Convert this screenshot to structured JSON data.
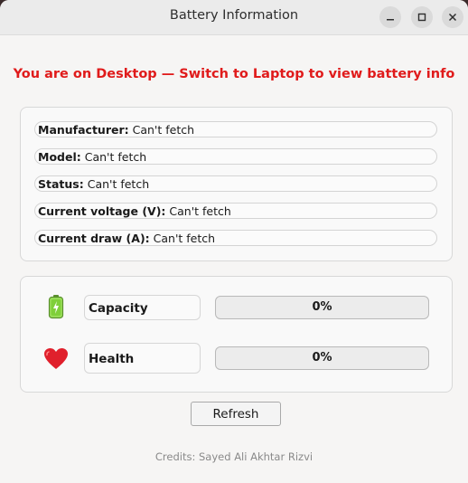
{
  "window": {
    "title": "Battery Information",
    "minimize_icon": "minimize-icon",
    "maximize_icon": "maximize-icon",
    "close_icon": "close-icon"
  },
  "warning": "You are on Desktop — Switch to Laptop to view battery info",
  "info": [
    {
      "label": "Manufacturer:",
      "value": "Can't fetch"
    },
    {
      "label": "Model:",
      "value": "Can't fetch"
    },
    {
      "label": "Status:",
      "value": "Can't fetch"
    },
    {
      "label": "Current voltage (V):",
      "value": "Can't fetch"
    },
    {
      "label": "Current draw (A):",
      "value": "Can't fetch"
    }
  ],
  "meters": [
    {
      "icon": "battery-icon",
      "label": "Capacity",
      "value_text": "0%",
      "fraction": 0
    },
    {
      "icon": "heart-icon",
      "label": "Health",
      "value_text": "0%",
      "fraction": 0
    }
  ],
  "refresh_label": "Refresh",
  "credits": "Credits: Sayed Ali Akhtar Rizvi",
  "colors": {
    "warning": "#e01b1b",
    "progress_fill": "#3584e4",
    "battery_green": "#7fcf3a",
    "heart_red": "#e0202c"
  }
}
